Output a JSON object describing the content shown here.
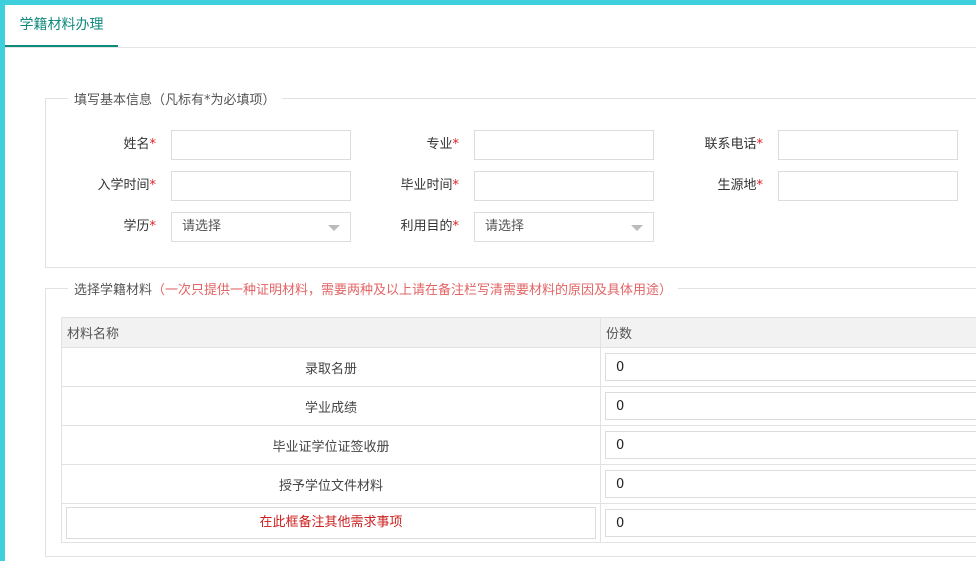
{
  "tab": {
    "label": "学籍材料办理"
  },
  "basic": {
    "legend": "填写基本信息（凡标有*为必填项）",
    "fields": [
      {
        "label": "姓名",
        "required": "*",
        "value": ""
      },
      {
        "label": "专业",
        "required": "*",
        "value": ""
      },
      {
        "label": "联系电话",
        "required": "*",
        "value": ""
      },
      {
        "label": "入学时间",
        "required": "*",
        "value": ""
      },
      {
        "label": "毕业时间",
        "required": "*",
        "value": ""
      },
      {
        "label": "生源地",
        "required": "*",
        "value": ""
      }
    ],
    "selects": [
      {
        "label": "学历",
        "required": "*",
        "value": "请选择"
      },
      {
        "label": "利用目的",
        "required": "*",
        "value": "请选择"
      }
    ]
  },
  "materials": {
    "legend": "选择学籍材料",
    "legend_note": "（一次只提供一种证明材料，需要两种及以上请在备注栏写清需要材料的原因及具体用途）",
    "headers": [
      "材料名称",
      "份数"
    ],
    "rows": [
      {
        "name": "录取名册",
        "qty": "0"
      },
      {
        "name": "学业成绩",
        "qty": "0"
      },
      {
        "name": "毕业证学位证签收册",
        "qty": "0"
      },
      {
        "name": "授予学位文件材料",
        "qty": "0"
      }
    ],
    "note_placeholder": "在此框备注其他需求事项",
    "note_qty": "0"
  },
  "colors": {
    "accent": "#0e8a7c",
    "frame": "#3dd0dc",
    "required": "#e02020",
    "note": "#cc1f1f"
  }
}
